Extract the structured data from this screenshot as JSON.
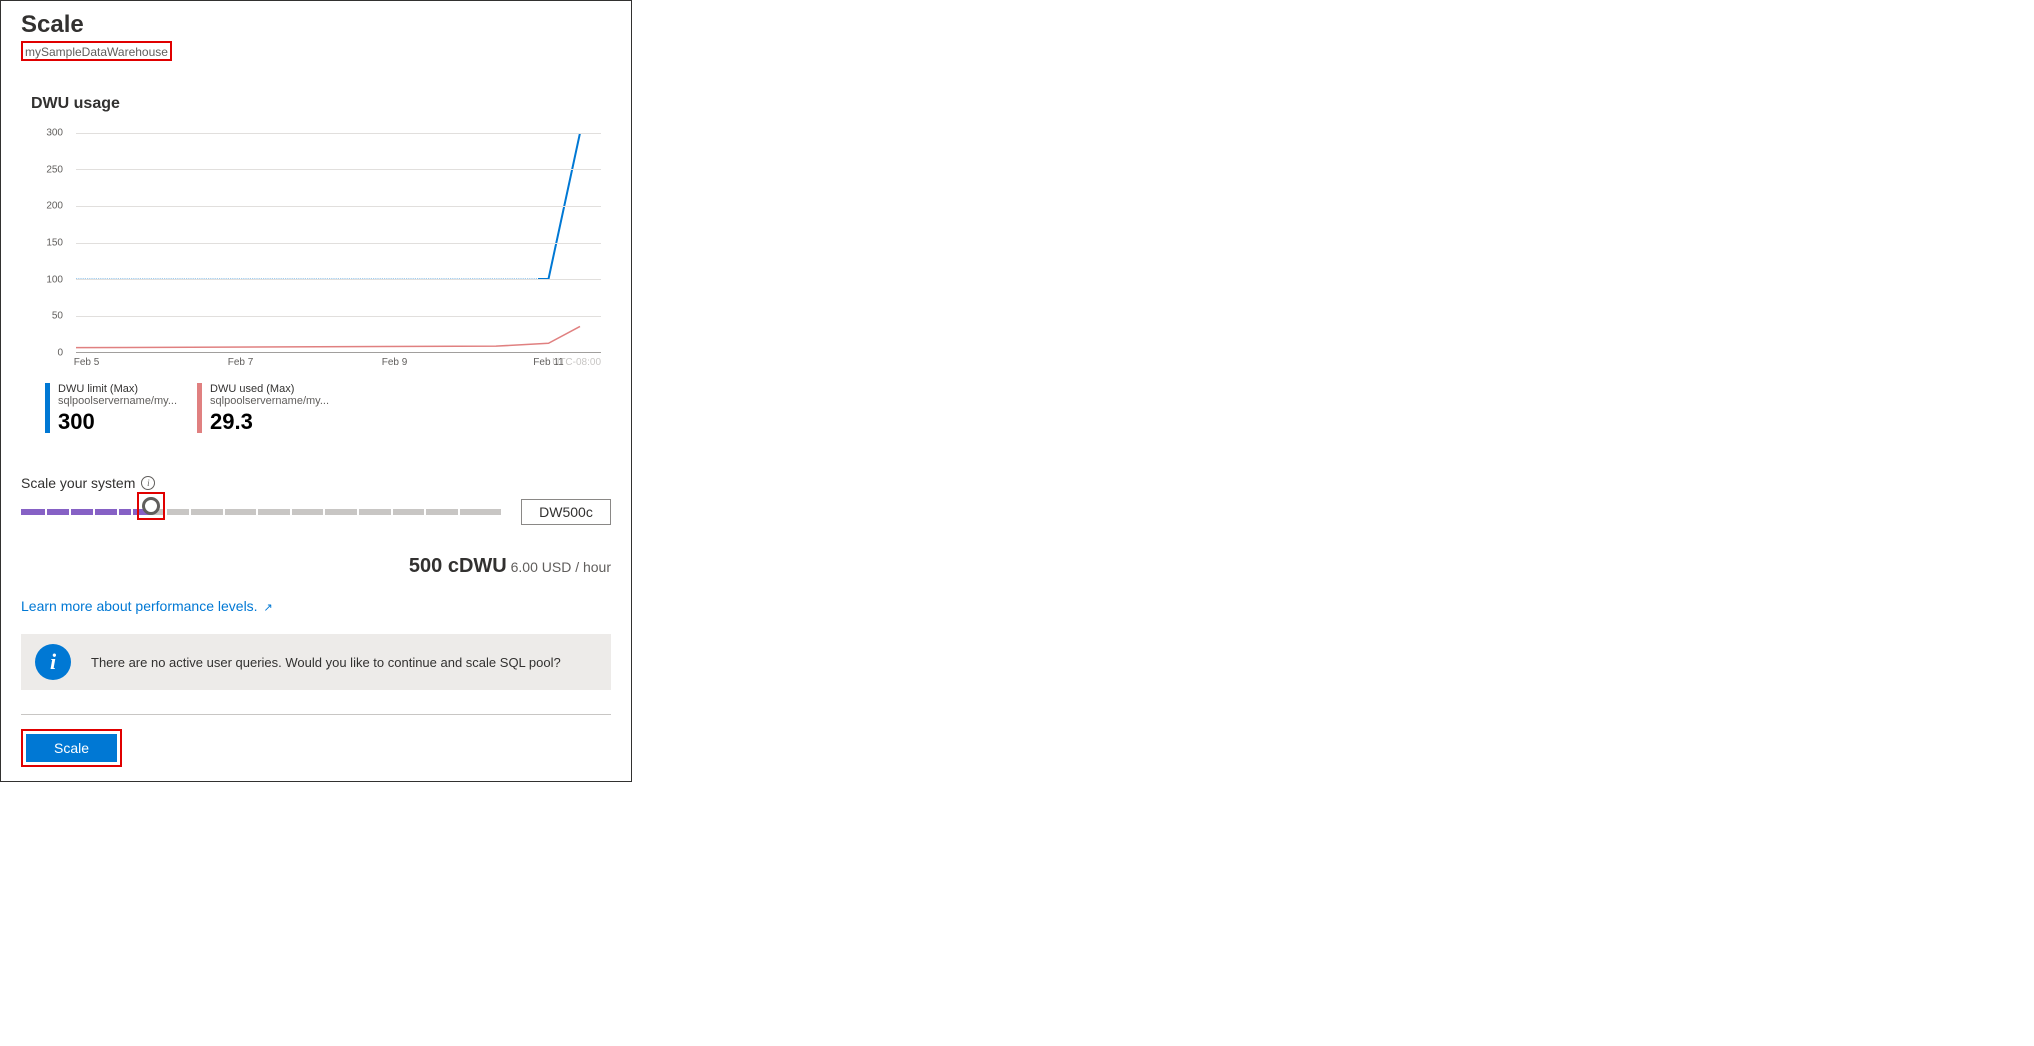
{
  "header": {
    "title": "Scale",
    "subtitle": "mySampleDataWarehouse"
  },
  "usage": {
    "title": "DWU usage",
    "timezone": "UTC-08:00"
  },
  "chart_data": {
    "type": "line",
    "xlabel": "",
    "ylabel": "",
    "ylim": [
      0,
      300
    ],
    "y_ticks": [
      0,
      50,
      100,
      150,
      200,
      250,
      300
    ],
    "x_ticks": [
      "Feb 5",
      "Feb 7",
      "Feb 9",
      "Feb 11"
    ],
    "series": [
      {
        "name": "DWU limit (Max)",
        "color": "#0078d4",
        "style": "dashed-then-solid",
        "x": [
          0,
          88,
          90,
          96
        ],
        "values": [
          100,
          100,
          100,
          300
        ]
      },
      {
        "name": "DWU used (Max)",
        "color": "#e08080",
        "style": "solid",
        "x": [
          0,
          80,
          90,
          96
        ],
        "values": [
          6,
          8,
          12,
          35
        ]
      }
    ]
  },
  "legend": [
    {
      "title": "DWU limit (Max)",
      "sub": "sqlpoolservername/my...",
      "value": "300"
    },
    {
      "title": "DWU used (Max)",
      "sub": "sqlpoolservername/my...",
      "value": "29.3"
    }
  ],
  "slider": {
    "label": "Scale your system",
    "value_display": "DW500c",
    "fill_percent": 27,
    "ticks_percent": [
      5,
      10,
      15,
      20,
      23,
      30,
      35,
      42,
      49,
      56,
      63,
      70,
      77,
      84,
      91
    ]
  },
  "cost": {
    "bold": "500 cDWU",
    "rest": "6.00 USD / hour"
  },
  "link": {
    "text": "Learn more about performance levels."
  },
  "banner": {
    "text": "There are no active user queries. Would you like to continue and scale SQL pool?"
  },
  "footer": {
    "button": "Scale"
  }
}
